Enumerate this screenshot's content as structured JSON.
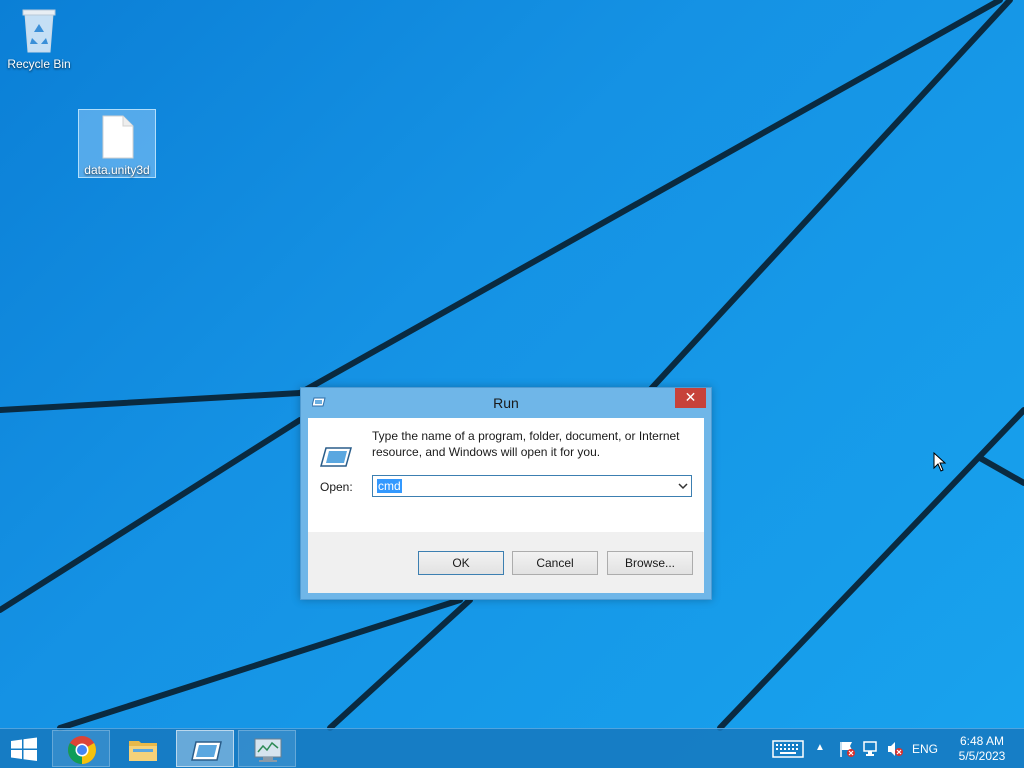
{
  "desktop": {
    "icons": [
      {
        "label": "Recycle Bin",
        "icon": "recycle-bin-icon"
      },
      {
        "label": "data.unity3d",
        "icon": "file-icon"
      }
    ]
  },
  "run_dialog": {
    "title": "Run",
    "close_label": "✕",
    "description": "Type the name of a program, folder, document, or Internet resource, and Windows will open it for you.",
    "open_label": "Open:",
    "open_value": "cmd",
    "buttons": {
      "ok": "OK",
      "cancel": "Cancel",
      "browse": "Browse..."
    }
  },
  "taskbar": {
    "apps": [
      {
        "name": "Google Chrome",
        "icon": "chrome-icon"
      },
      {
        "name": "File Explorer",
        "icon": "folder-icon"
      },
      {
        "name": "Run",
        "icon": "run-icon",
        "active": true
      },
      {
        "name": "Performance Monitor",
        "icon": "monitor-icon"
      }
    ],
    "tray": {
      "arrow": "▲",
      "language": "ENG",
      "time": "6:48 AM",
      "date": "5/5/2023"
    }
  },
  "colors": {
    "desktop_bg": "#1592e4",
    "taskbar_bg": "#1678be",
    "dialog_border": "#6fb6e8",
    "close_button": "#c7423a",
    "selection": "#3399ff"
  }
}
